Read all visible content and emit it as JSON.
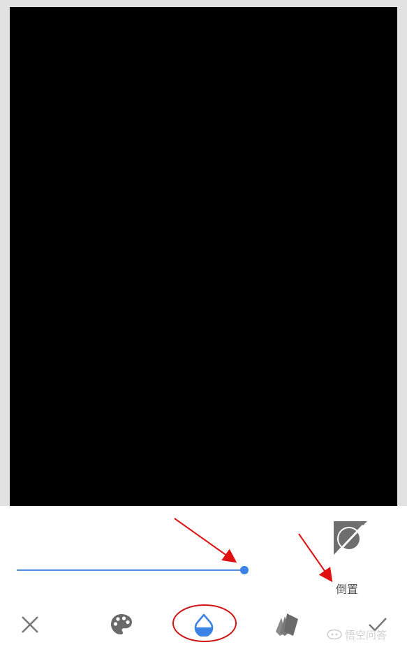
{
  "preview": {
    "frame_color": "#e2e2e2",
    "image_color": "#000000"
  },
  "adjustment": {
    "slider_value": 1.0,
    "accent_color": "#3b82e6",
    "invert_label": "倒置",
    "invert_icon": "invert-icon"
  },
  "toolbar": {
    "items": [
      {
        "name": "close",
        "icon": "close-icon"
      },
      {
        "name": "color",
        "icon": "palette-icon"
      },
      {
        "name": "opacity",
        "icon": "water-drop-icon",
        "active": true
      },
      {
        "name": "style",
        "icon": "style-cards-icon"
      },
      {
        "name": "apply",
        "icon": "check-icon"
      }
    ],
    "icon_color": "#777777",
    "active_color": "#3b82e6"
  },
  "annotations": {
    "arrow_color": "#e01010",
    "highlight_color": "#d01414"
  },
  "watermark": {
    "text": "悟空问答"
  }
}
